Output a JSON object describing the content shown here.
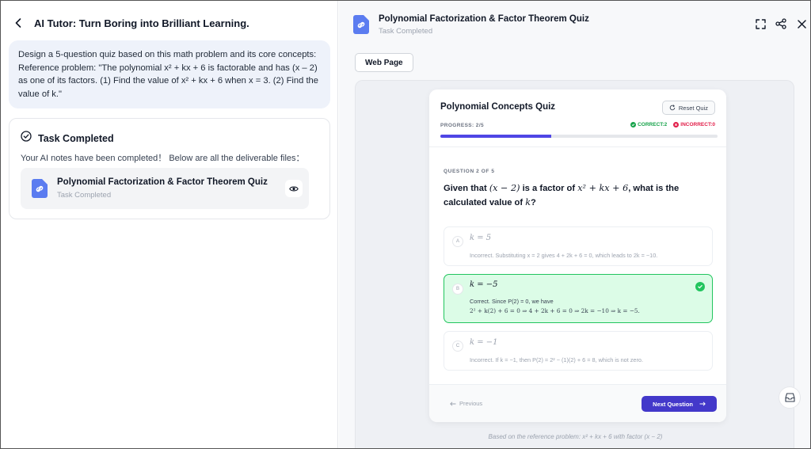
{
  "left": {
    "title": "AI Tutor: Turn Boring into Brilliant Learning.",
    "prompt": "Design a 5-question quiz based on this math problem and its core concepts: Reference problem: \"The polynomial x² + kx + 6 is factorable and has (x – 2) as one of its factors. (1) Find the value of x² + kx + 6 when x = 3. (2) Find the value of k.\"",
    "task": {
      "title": "Task Completed",
      "note": "Your AI notes have been completed！ Below are all the deliverable files：",
      "file_name": "Polynomial Factorization & Factor Theorem Quiz",
      "file_status": "Task Completed"
    }
  },
  "right": {
    "title": "Polynomial Factorization & Factor Theorem Quiz",
    "status": "Task Completed",
    "tab_label": "Web Page",
    "icons": [
      "fullscreen-icon",
      "share-icon",
      "close-icon"
    ]
  },
  "quiz": {
    "title": "Polynomial Concepts Quiz",
    "reset_label": "Reset Quiz",
    "progress_label": "PROGRESS: 2/5",
    "progress_fraction": 0.4,
    "correct_label": "CORRECT:2",
    "incorrect_label": "INCORRECT:0",
    "question_label": "QUESTION 2 OF 5",
    "question_prefix": "Given that ",
    "question_math1": "(x − 2)",
    "question_mid": " is a factor of ",
    "question_math2": "x² + kx + 6",
    "question_mid2": ", what is the calculated value of ",
    "question_math3": "k",
    "question_end": "?",
    "options": [
      {
        "letter": "A",
        "text": "k = 5",
        "explanation": "Incorrect. Substituting x = 2 gives 4 + 2k + 6 = 0, which leads to 2k = −10.",
        "explanation2": ""
      },
      {
        "letter": "B",
        "text": "k = −5",
        "explanation": "Correct. Since P(2) = 0, we have",
        "explanation2": "2² + k(2) + 6 = 0 ⇒ 4 + 2k + 6 = 0 ⇒ 2k = −10 ⇒ k = −5."
      },
      {
        "letter": "C",
        "text": "k = −1",
        "explanation": "Incorrect. If k = −1, then P(2) = 2² − (1)(2) + 6 = 8, which is not zero.",
        "explanation2": ""
      }
    ],
    "prev_label": "Previous",
    "next_label": "Next Question",
    "footnote": "Based on the reference problem: x² + kx + 6 with factor (x − 2)"
  },
  "colors": {
    "accent": "#4f46e5",
    "correct": "#16a34a",
    "incorrect": "#e11d48",
    "selected_bg": "#dcfce7"
  }
}
